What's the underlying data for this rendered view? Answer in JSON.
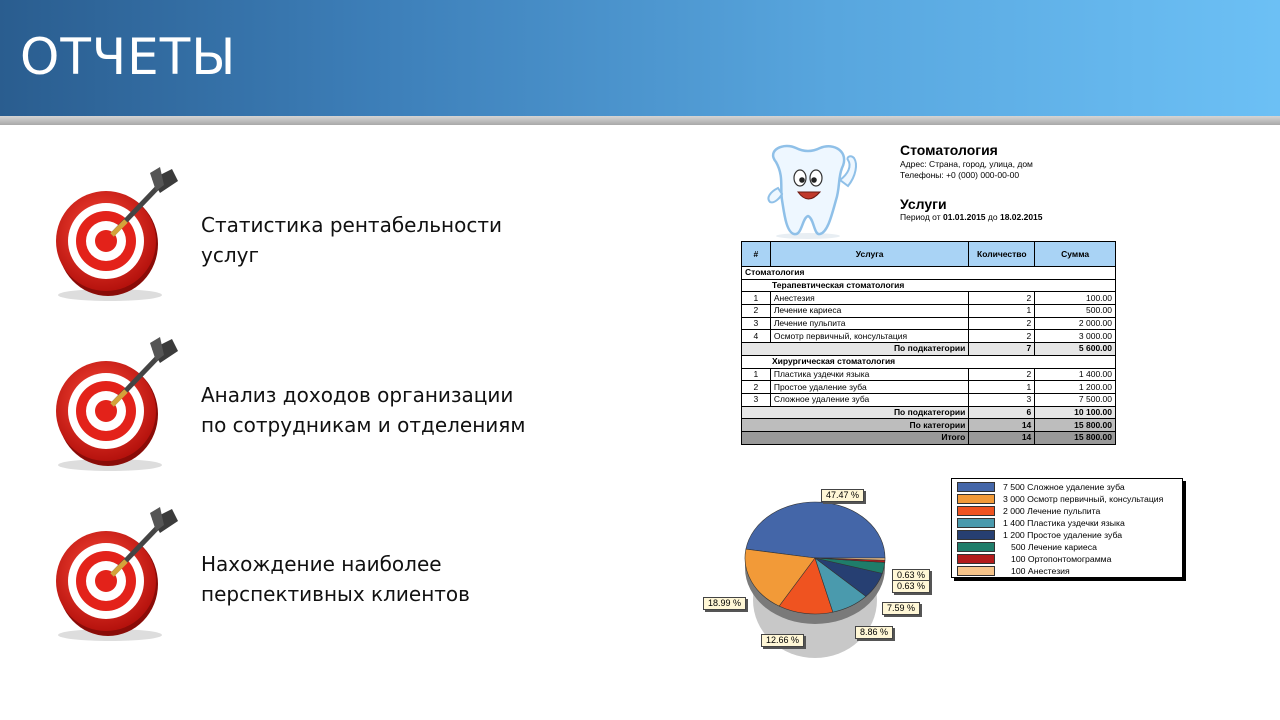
{
  "header": {
    "title": "ОТЧЕТЫ"
  },
  "bullets": [
    {
      "line1": "Статистика рентабельности",
      "line2": "услуг"
    },
    {
      "line1": "Анализ доходов организации",
      "line2": "по сотрудникам и отделениям"
    },
    {
      "line1": "Нахождение наиболее",
      "line2": "перспективных клиентов"
    }
  ],
  "icons": {
    "target": "target-dart-icon",
    "mascot": "tooth-mascot-icon"
  },
  "report": {
    "clinic": "Стоматология",
    "address": "Адрес: Страна, город, улица, дом",
    "phone": "Телефоны: +0 (000) 000-00-00",
    "subtitle": "Услуги",
    "period_prefix": "Период от",
    "date_from": "01.01.2015",
    "period_mid": "до",
    "date_to": "18.02.2015",
    "columns": [
      "#",
      "Услуга",
      "Количество",
      "Сумма"
    ],
    "category": "Стоматология",
    "groups": [
      {
        "name": "Терапевтическая стоматология",
        "rows": [
          {
            "n": "1",
            "service": "Анестезия",
            "qty": "2",
            "sum": "100.00"
          },
          {
            "n": "2",
            "service": "Лечение кариеса",
            "qty": "1",
            "sum": "500.00"
          },
          {
            "n": "3",
            "service": "Лечение пульпита",
            "qty": "2",
            "sum": "2 000.00"
          },
          {
            "n": "4",
            "service": "Осмотр первичный, консультация",
            "qty": "2",
            "sum": "3 000.00"
          }
        ],
        "subtotal_label": "По подкатегории",
        "subtotal_qty": "7",
        "subtotal_sum": "5 600.00"
      },
      {
        "name": "Хирургическая стоматология",
        "rows": [
          {
            "n": "1",
            "service": "Пластика уздечки языка",
            "qty": "2",
            "sum": "1 400.00"
          },
          {
            "n": "2",
            "service": "Простое удаление зуба",
            "qty": "1",
            "sum": "1 200.00"
          },
          {
            "n": "3",
            "service": "Сложное удаление зуба",
            "qty": "3",
            "sum": "7 500.00"
          }
        ],
        "subtotal_label": "По подкатегории",
        "subtotal_qty": "6",
        "subtotal_sum": "10 100.00"
      }
    ],
    "category_total_label": "По категории",
    "category_total_qty": "14",
    "category_total_sum": "15 800.00",
    "grand_total_label": "Итого",
    "grand_total_qty": "14",
    "grand_total_sum": "15 800.00"
  },
  "chart_data": {
    "type": "pie",
    "title": "",
    "slices": [
      {
        "value": 7500,
        "label": "7 500 Сложное удаление зуба",
        "pct": "47.47 %",
        "color": "#4466a8"
      },
      {
        "value": 3000,
        "label": "3 000 Осмотр первичный, консультация",
        "pct": "18.99 %",
        "color": "#f29a38"
      },
      {
        "value": 2000,
        "label": "2 000 Лечение пульпита",
        "pct": "12.66 %",
        "color": "#ef5320"
      },
      {
        "value": 1400,
        "label": "1 400 Пластика уздечки языка",
        "pct": "8.86 %",
        "color": "#4a9aad"
      },
      {
        "value": 1200,
        "label": "1 200 Простое удаление зуба",
        "pct": "7.59 %",
        "color": "#263f72"
      },
      {
        "value": 500,
        "label": "500 Лечение кариеса",
        "pct": "",
        "color": "#1f7d6a"
      },
      {
        "value": 100,
        "label": "100 Ортопонтомограмма",
        "pct": "0.63 %",
        "color": "#b31b1b"
      },
      {
        "value": 100,
        "label": "100 Анестезия",
        "pct": "0.63 %",
        "color": "#f6c48a"
      }
    ],
    "legend_position": "right"
  }
}
